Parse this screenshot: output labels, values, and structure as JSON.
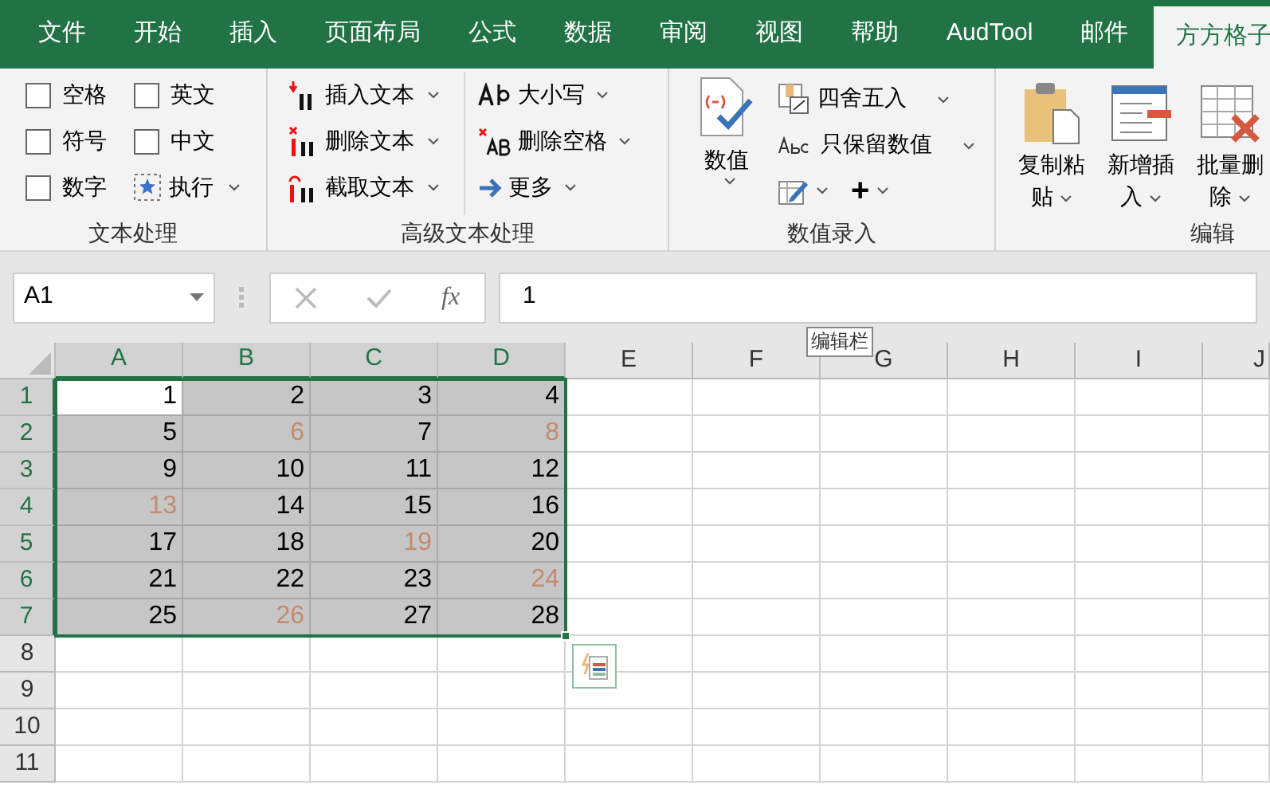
{
  "tabs": [
    {
      "label": "文件",
      "selected": false
    },
    {
      "label": "开始",
      "selected": false
    },
    {
      "label": "插入",
      "selected": false
    },
    {
      "label": "页面布局",
      "selected": false
    },
    {
      "label": "公式",
      "selected": false
    },
    {
      "label": "数据",
      "selected": false
    },
    {
      "label": "审阅",
      "selected": false
    },
    {
      "label": "视图",
      "selected": false
    },
    {
      "label": "帮助",
      "selected": false
    },
    {
      "label": "AudTool",
      "selected": false
    },
    {
      "label": "邮件",
      "selected": false
    },
    {
      "label": "方方格子",
      "selected": true
    }
  ],
  "text_group": {
    "label": "文本处理",
    "checkboxes": [
      {
        "label": "空格",
        "checked": false
      },
      {
        "label": "英文",
        "checked": false
      },
      {
        "label": "符号",
        "checked": false
      },
      {
        "label": "中文",
        "checked": false
      },
      {
        "label": "数字",
        "checked": false
      }
    ],
    "run_button": "执行"
  },
  "advanced_group": {
    "label": "高级文本处理",
    "buttons": [
      {
        "kind": "insert",
        "label": "插入文本"
      },
      {
        "kind": "delete",
        "label": "删除文本"
      },
      {
        "kind": "extract",
        "label": "截取文本"
      },
      {
        "kind": "case",
        "label": "大小写"
      },
      {
        "kind": "space",
        "label": "删除空格"
      },
      {
        "kind": "more",
        "label": "更多"
      }
    ]
  },
  "number_group": {
    "label": "数值录入",
    "big_button": "数值",
    "buttons": [
      {
        "kind": "round",
        "label": "四舍五入"
      },
      {
        "kind": "keep",
        "label": "只保留数值"
      }
    ],
    "plus": "+"
  },
  "edit_group": {
    "label": "编辑",
    "buttons": [
      {
        "kind": "paste",
        "label": "复制粘贴"
      },
      {
        "kind": "insert",
        "label": "新增插入"
      },
      {
        "kind": "delete",
        "label": "批量删除"
      }
    ]
  },
  "formula_bar": {
    "name_box": "A1",
    "value": "1",
    "fx": "fx",
    "tooltip": "编辑栏"
  },
  "grid": {
    "columns": [
      {
        "label": "A",
        "selected": true
      },
      {
        "label": "B",
        "selected": true
      },
      {
        "label": "C",
        "selected": true
      },
      {
        "label": "D",
        "selected": true
      },
      {
        "label": "E",
        "selected": false
      },
      {
        "label": "F",
        "selected": false
      },
      {
        "label": "G",
        "selected": false
      },
      {
        "label": "H",
        "selected": false
      },
      {
        "label": "I",
        "selected": false
      },
      {
        "label": "J",
        "selected": false
      }
    ],
    "rows": [
      {
        "header": "1",
        "selected": true,
        "cells": [
          {
            "value": "1",
            "color": "#000000",
            "active": true
          },
          {
            "value": "2",
            "color": "#000000",
            "active": false
          },
          {
            "value": "3",
            "color": "#000000",
            "active": false
          },
          {
            "value": "4",
            "color": "#000000",
            "active": false
          }
        ]
      },
      {
        "header": "2",
        "selected": true,
        "cells": [
          {
            "value": "5",
            "color": "#000000",
            "active": false
          },
          {
            "value": "6",
            "color": "#c48a6e",
            "active": false
          },
          {
            "value": "7",
            "color": "#000000",
            "active": false
          },
          {
            "value": "8",
            "color": "#c48a6e",
            "active": false
          }
        ]
      },
      {
        "header": "3",
        "selected": true,
        "cells": [
          {
            "value": "9",
            "color": "#000000",
            "active": false
          },
          {
            "value": "10",
            "color": "#000000",
            "active": false
          },
          {
            "value": "11",
            "color": "#000000",
            "active": false
          },
          {
            "value": "12",
            "color": "#000000",
            "active": false
          }
        ]
      },
      {
        "header": "4",
        "selected": true,
        "cells": [
          {
            "value": "13",
            "color": "#c48a6e",
            "active": false
          },
          {
            "value": "14",
            "color": "#000000",
            "active": false
          },
          {
            "value": "15",
            "color": "#000000",
            "active": false
          },
          {
            "value": "16",
            "color": "#000000",
            "active": false
          }
        ]
      },
      {
        "header": "5",
        "selected": true,
        "cells": [
          {
            "value": "17",
            "color": "#000000",
            "active": false
          },
          {
            "value": "18",
            "color": "#000000",
            "active": false
          },
          {
            "value": "19",
            "color": "#c48a6e",
            "active": false
          },
          {
            "value": "20",
            "color": "#000000",
            "active": false
          }
        ]
      },
      {
        "header": "6",
        "selected": true,
        "cells": [
          {
            "value": "21",
            "color": "#000000",
            "active": false
          },
          {
            "value": "22",
            "color": "#000000",
            "active": false
          },
          {
            "value": "23",
            "color": "#000000",
            "active": false
          },
          {
            "value": "24",
            "color": "#c48a6e",
            "active": false
          }
        ]
      },
      {
        "header": "7",
        "selected": true,
        "cells": [
          {
            "value": "25",
            "color": "#000000",
            "active": false
          },
          {
            "value": "26",
            "color": "#c48a6e",
            "active": false
          },
          {
            "value": "27",
            "color": "#000000",
            "active": false
          },
          {
            "value": "28",
            "color": "#000000",
            "active": false
          }
        ]
      },
      {
        "header": "8",
        "selected": false,
        "cells": []
      },
      {
        "header": "9",
        "selected": false,
        "cells": []
      },
      {
        "header": "10",
        "selected": false,
        "cells": []
      },
      {
        "header": "11",
        "selected": false,
        "cells": []
      }
    ]
  }
}
